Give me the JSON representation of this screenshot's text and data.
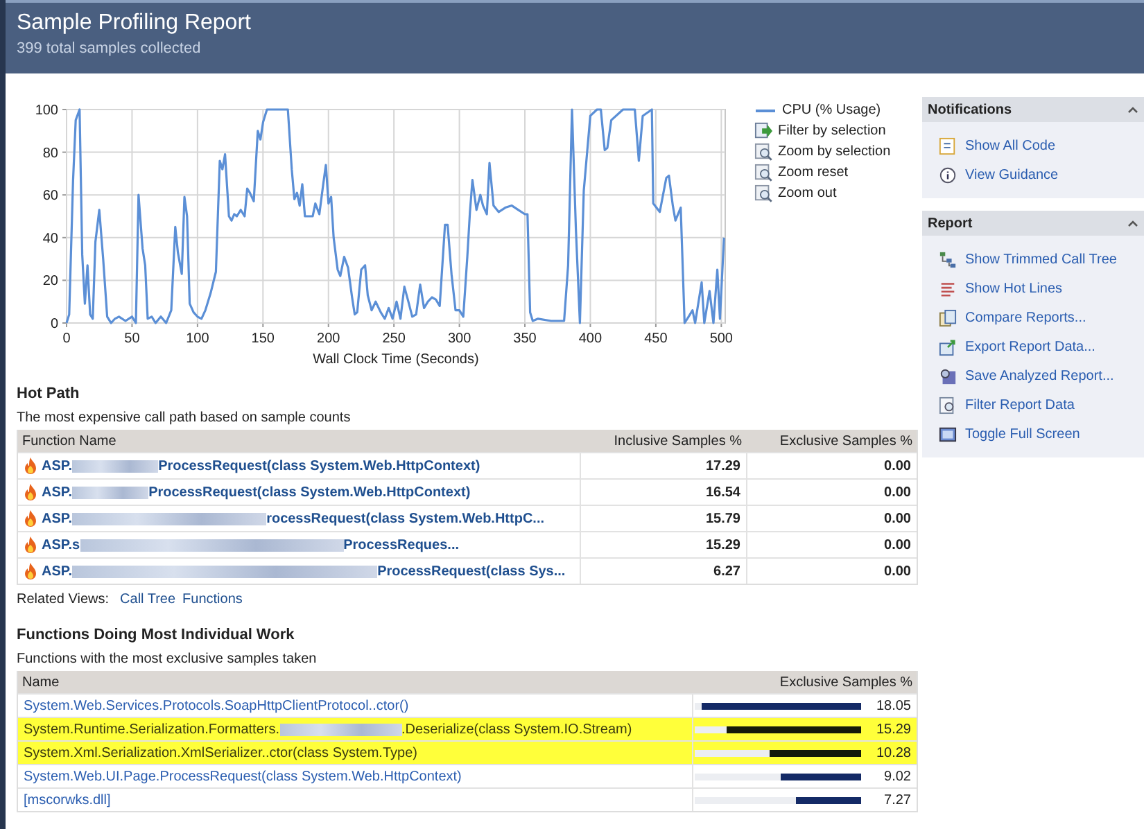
{
  "header": {
    "title": "Sample Profiling Report",
    "subtitle": "399 total samples collected"
  },
  "cpu_chart": {
    "actions": [
      {
        "label": "Filter by selection",
        "kind": "filter"
      },
      {
        "label": "Zoom by selection",
        "kind": "zoom"
      },
      {
        "label": "Zoom reset",
        "kind": "zoom"
      },
      {
        "label": "Zoom out",
        "kind": "zoom"
      }
    ],
    "chart_data": {
      "type": "line",
      "grid": true,
      "xlabel": "Wall Clock Time (Seconds)",
      "xlim": [
        0,
        503
      ],
      "ylim": [
        0,
        100
      ],
      "xticks": [
        0,
        50,
        100,
        150,
        200,
        250,
        300,
        350,
        400,
        450,
        500
      ],
      "yticks": [
        0,
        20,
        40,
        60,
        80,
        100
      ],
      "x": [
        0,
        2,
        5,
        7,
        10,
        12,
        14,
        16,
        18,
        20,
        22,
        25,
        28,
        31,
        34,
        37,
        40,
        45,
        50,
        53,
        55,
        58,
        60,
        62,
        65,
        68,
        72,
        76,
        80,
        83,
        85,
        88,
        90,
        92,
        94,
        97,
        100,
        103,
        106,
        110,
        114,
        117,
        119,
        121,
        124,
        126,
        128,
        130,
        133,
        136,
        138,
        140,
        143,
        146,
        148,
        150,
        153,
        156,
        160,
        165,
        169,
        172,
        174,
        176,
        178,
        180,
        182,
        185,
        188,
        190,
        193,
        196,
        198,
        200,
        202,
        204,
        207,
        209,
        212,
        215,
        218,
        220,
        222,
        225,
        228,
        230,
        233,
        236,
        240,
        243,
        246,
        249,
        252,
        255,
        258,
        261,
        264,
        267,
        270,
        273,
        276,
        279,
        282,
        285,
        289,
        291,
        294,
        297,
        300,
        303,
        306,
        308,
        310,
        313,
        316,
        318,
        321,
        323,
        326,
        330,
        335,
        340,
        345,
        350,
        352,
        354,
        356,
        360,
        370,
        380,
        383,
        386,
        389,
        392,
        395,
        400,
        405,
        408,
        411,
        413,
        416,
        425,
        434,
        437,
        440,
        447,
        448,
        453,
        458,
        460,
        463,
        465,
        469,
        472,
        475,
        478,
        480,
        485,
        487,
        491,
        494,
        497,
        499,
        502
      ],
      "series": [
        {
          "name": "CPU (% Usage)",
          "color": "#5b8fd6",
          "values": [
            0,
            4,
            67,
            95,
            100,
            32,
            9,
            27,
            4,
            2,
            38,
            53,
            30,
            3,
            0,
            2,
            3,
            1,
            3,
            0,
            60,
            35,
            27,
            2,
            3,
            0,
            3,
            0,
            6,
            45,
            33,
            23,
            59,
            50,
            9,
            5,
            3,
            2,
            6,
            14,
            24,
            76,
            72,
            79,
            50,
            48,
            51,
            50,
            53,
            50,
            63,
            61,
            57,
            90,
            86,
            94,
            100,
            100,
            100,
            100,
            100,
            72,
            58,
            61,
            55,
            65,
            50,
            50,
            50,
            56,
            51,
            65,
            74,
            56,
            59,
            40,
            25,
            22,
            31,
            26,
            12,
            4,
            5,
            25,
            27,
            13,
            6,
            10,
            5,
            2,
            7,
            2,
            10,
            2,
            17,
            10,
            3,
            4,
            18,
            7,
            10,
            12,
            11,
            8,
            46,
            46,
            23,
            6,
            6,
            3,
            31,
            52,
            67,
            53,
            60,
            55,
            51,
            75,
            55,
            52,
            54,
            55,
            53,
            51,
            51,
            5,
            1,
            2,
            1,
            1,
            27,
            100,
            44,
            0,
            62,
            97,
            100,
            100,
            81,
            82,
            95,
            100,
            100,
            76,
            97,
            100,
            56,
            52,
            68,
            69,
            55,
            48,
            54,
            0,
            3,
            6,
            0,
            19,
            0,
            15,
            0,
            25,
            2,
            40
          ]
        }
      ]
    }
  },
  "hot_path": {
    "title": "Hot Path",
    "description": "The most expensive call path based on sample counts",
    "columns": [
      "Function Name",
      "Inclusive Samples %",
      "Exclusive Samples %"
    ],
    "rows": [
      {
        "prefix": "ASP.",
        "suffix": "ProcessRequest(class System.Web.HttpContext)",
        "inclusive": "17.29",
        "exclusive": "0.00"
      },
      {
        "prefix": "ASP.",
        "suffix": "ProcessRequest(class System.Web.HttpContext)",
        "inclusive": "16.54",
        "exclusive": "0.00"
      },
      {
        "prefix": "ASP.",
        "suffix": "rocessRequest(class System.Web.HttpC...",
        "inclusive": "15.79",
        "exclusive": "0.00"
      },
      {
        "prefix": "ASP.s",
        "suffix": "ProcessReques...",
        "inclusive": "15.29",
        "exclusive": "0.00"
      },
      {
        "prefix": "ASP.",
        "suffix": "ProcessRequest(class Sys...",
        "inclusive": "6.27",
        "exclusive": "0.00"
      }
    ],
    "related_label": "Related Views:",
    "related_links": [
      "Call Tree",
      "Functions"
    ]
  },
  "individual_work": {
    "title": "Functions Doing Most Individual Work",
    "description": "Functions with the most exclusive samples taken",
    "columns": [
      "Name",
      "Exclusive Samples %"
    ],
    "rows": [
      {
        "name": "System.Web.Services.Protocols.SoapHttpClientProtocol..ctor()",
        "value": "18.05",
        "level": 0.96,
        "highlighted": false
      },
      {
        "name": "System.Runtime.Serialization.Formatters.",
        "name_suffix": ".Deserialize(class System.IO.Stream)",
        "value": "15.29",
        "level": 0.81,
        "highlighted": true
      },
      {
        "name": "System.Xml.Serialization.XmlSerializer..ctor(class System.Type)",
        "value": "10.28",
        "level": 0.55,
        "highlighted": true
      },
      {
        "name": "System.Web.UI.Page.ProcessRequest(class System.Web.HttpContext)",
        "value": "9.02",
        "level": 0.48,
        "highlighted": false
      },
      {
        "name": "[mscorwks.dll]",
        "value": "7.27",
        "level": 0.39,
        "highlighted": false
      }
    ]
  },
  "sidebar": [
    {
      "title": "Notifications",
      "expanded": true,
      "items": [
        {
          "label": "Show All Code",
          "kind": "code"
        },
        {
          "label": "View Guidance",
          "kind": "info"
        }
      ]
    },
    {
      "title": "Report",
      "expanded": true,
      "items": [
        {
          "label": "Show Trimmed Call Tree",
          "kind": "tree"
        },
        {
          "label": "Show Hot Lines",
          "kind": "lines"
        },
        {
          "label": "Compare Reports...",
          "kind": "compare"
        },
        {
          "label": "Export Report Data...",
          "kind": "export"
        },
        {
          "label": "Save Analyzed Report...",
          "kind": "save"
        },
        {
          "label": "Filter Report Data",
          "kind": "filter"
        },
        {
          "label": "Toggle Full Screen",
          "kind": "screen"
        }
      ]
    }
  ]
}
